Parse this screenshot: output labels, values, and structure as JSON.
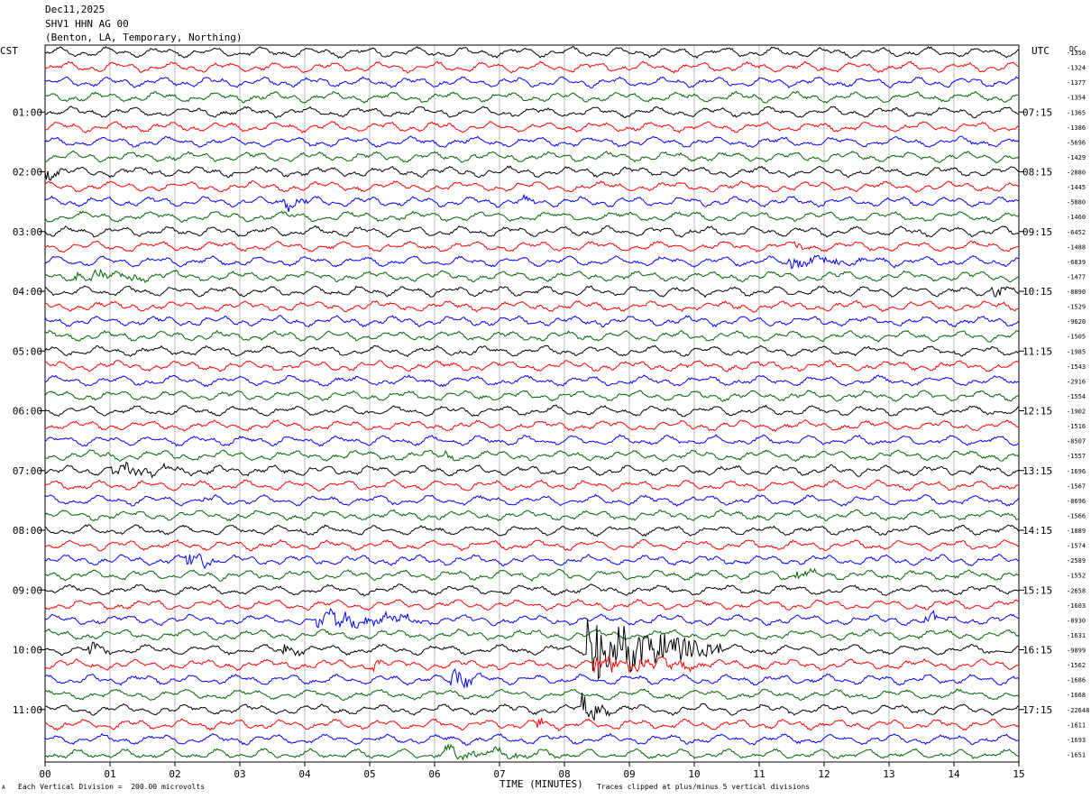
{
  "header": {
    "date": "Dec11,2025",
    "station": "SHV1 HHN AG 00",
    "location": "(Benton, LA, Temporary, Northing)"
  },
  "axes": {
    "left_tz": "CST",
    "right_tz": "UTC",
    "dc_label": "DC",
    "xlabel": "TIME (MINUTES)",
    "scale_note": "Each Vertical Division =  200.00 microvolts",
    "clip_note": "Traces clipped at plus/minus 5 vertical divisions",
    "corner_mark": "A"
  },
  "chart_data": {
    "type": "line",
    "title": "SHV1 HHN AG 00",
    "xlabel": "TIME (MINUTES)",
    "xlim": [
      0,
      15
    ],
    "x_ticks": [
      "00",
      "01",
      "02",
      "03",
      "04",
      "05",
      "06",
      "07",
      "08",
      "09",
      "10",
      "11",
      "12",
      "13",
      "14",
      "15"
    ],
    "traces_per_hour": 4,
    "trace_count": 48,
    "trace_minutes": 15,
    "trace_colors": [
      "#000000",
      "#ff0000",
      "#0000ff",
      "#006400"
    ],
    "left_hour_labels": [
      "01:00",
      "02:00",
      "03:00",
      "04:00",
      "05:00",
      "06:00",
      "07:00",
      "08:00",
      "09:00",
      "10:00",
      "11:00"
    ],
    "right_hour_labels": [
      "07:15",
      "08:15",
      "09:15",
      "10:15",
      "11:15",
      "12:15",
      "13:15",
      "14:15",
      "15:15",
      "16:15",
      "17:15"
    ],
    "dc_offsets": [
      "-1350",
      "-1324",
      "-1377",
      "-1354",
      "-1365",
      "-1386",
      "-5696",
      "-1429",
      "-2880",
      "-1445",
      "-5880",
      "-1460",
      "-6452",
      "-1488",
      "-6839",
      "-1477",
      "-8890",
      "-1529",
      "-9620",
      "-1505",
      "-1985",
      "-1543",
      "-2916",
      "-1554",
      "-1902",
      "-1516",
      "-8507",
      "-1557",
      "-1696",
      "-1567",
      "-8696",
      "-1566",
      "-1889",
      "-1574",
      "-2589",
      "-1552",
      "-2658",
      "-1603",
      "-8930",
      "-1631",
      "-9899",
      "-1562",
      "-1686",
      "-1668",
      "-22648",
      "-1611",
      "-1693",
      "-1651"
    ],
    "series": [
      {
        "name": "Dec11,2025 00:00-12:00 CST",
        "units": "microvolts",
        "division_microvolts": 200,
        "clip_divisions": 5
      }
    ],
    "events": [
      {
        "trace": 8,
        "minute": 0.05,
        "level": "moderate"
      },
      {
        "trace": 10,
        "minute": 3.7,
        "level": "moderate"
      },
      {
        "trace": 10,
        "minute": 7.4,
        "level": "low"
      },
      {
        "trace": 13,
        "minute": 11.6,
        "level": "low"
      },
      {
        "trace": 14,
        "minute": 11.5,
        "level": "moderate-long"
      },
      {
        "trace": 15,
        "minute": 0.5,
        "level": "moderate-long"
      },
      {
        "trace": 16,
        "minute": 14.6,
        "level": "moderate"
      },
      {
        "trace": 27,
        "minute": 6.2,
        "level": "low"
      },
      {
        "trace": 28,
        "minute": 1.0,
        "level": "moderate-long"
      },
      {
        "trace": 30,
        "minute": 2.5,
        "level": "low"
      },
      {
        "trace": 34,
        "minute": 2.2,
        "level": "high"
      },
      {
        "trace": 35,
        "minute": 11.6,
        "level": "moderate"
      },
      {
        "trace": 38,
        "minute": 4.2,
        "level": "high-long"
      },
      {
        "trace": 38,
        "minute": 13.6,
        "level": "moderate"
      },
      {
        "trace": 40,
        "minute": 0.7,
        "level": "moderate"
      },
      {
        "trace": 40,
        "minute": 3.7,
        "level": "moderate"
      },
      {
        "trace": 40,
        "minute": 8.4,
        "level": "extreme-long"
      },
      {
        "trace": 41,
        "minute": 5.1,
        "level": "moderate"
      },
      {
        "trace": 41,
        "minute": 8.5,
        "level": "high-long"
      },
      {
        "trace": 42,
        "minute": 6.3,
        "level": "high"
      },
      {
        "trace": 44,
        "minute": 8.3,
        "level": "high"
      },
      {
        "trace": 45,
        "minute": 7.6,
        "level": "moderate"
      },
      {
        "trace": 47,
        "minute": 6.2,
        "level": "moderate-long"
      }
    ]
  }
}
